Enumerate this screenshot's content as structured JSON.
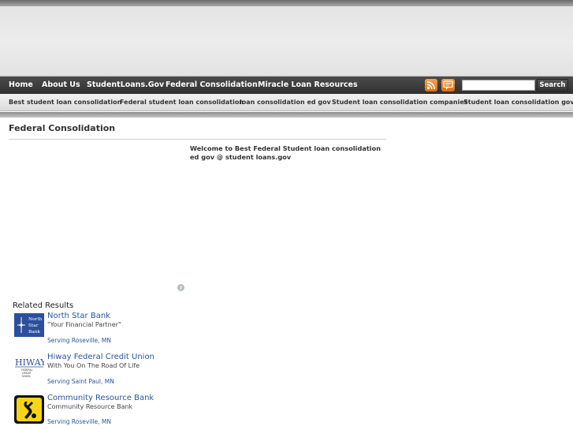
{
  "nav": {
    "items": [
      {
        "label": "Home"
      },
      {
        "label": "About Us"
      },
      {
        "label": "StudentLoans.Gov"
      },
      {
        "label": "Federal Consolidation"
      },
      {
        "label": "Miracle Loan Resources"
      }
    ],
    "search_button": "Search"
  },
  "subnav": {
    "items": [
      {
        "label": "Best student loan consolidation"
      },
      {
        "label": "Federal student loan consolidation"
      },
      {
        "label": "loan consolidation ed gov"
      },
      {
        "label": "Student loan consolidation companies"
      },
      {
        "label": "Student loan consolidation gov"
      }
    ]
  },
  "main": {
    "title": "Federal Consolidation",
    "welcome": "Welcome to Best Federal Student loan consolidation ed gov @ student loans.gov"
  },
  "related": {
    "title": "Related Results",
    "results": [
      {
        "name": "North Star Bank",
        "tagline": "\"Your Financial Partner\"",
        "serving": "Serving Roseville, MN",
        "logo_text": [
          "North",
          "Star",
          "Bank"
        ]
      },
      {
        "name": "Hiway Federal Credit Union",
        "tagline": "With You On The Road Of Life",
        "serving": "Serving Saint Paul, MN",
        "logo_text": [
          "HIWAY",
          "FEDERAL",
          "CREDIT",
          "UNION"
        ]
      },
      {
        "name": "Community Resource Bank",
        "tagline": "Community Resource Bank",
        "serving": "Serving Roseville, MN"
      }
    ]
  },
  "colors": {
    "nav_bg": "#3a3a3a",
    "link": "#2a55a0",
    "rss_orange": "#f08a24"
  }
}
